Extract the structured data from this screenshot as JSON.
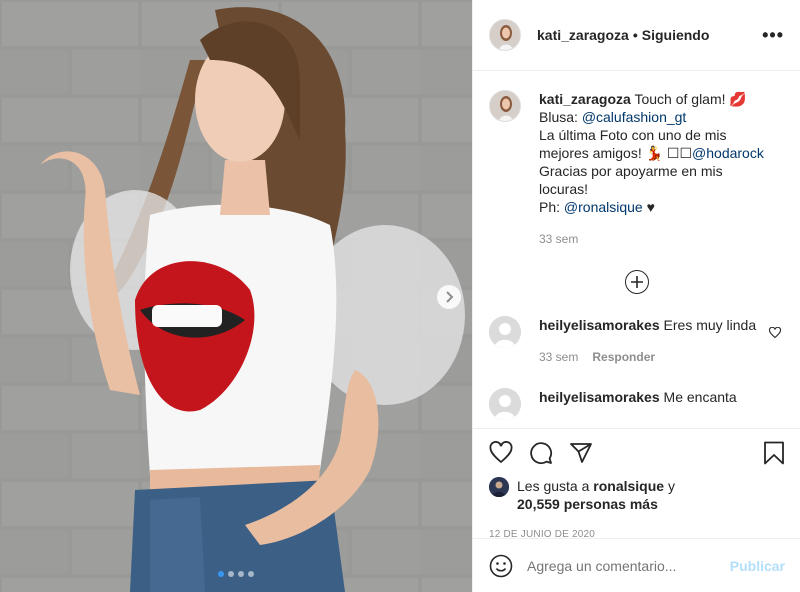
{
  "post": {
    "username": "kati_zaragoza",
    "separator": "•",
    "follow_status": "Siguiendo",
    "more_label": "•••"
  },
  "caption": {
    "username": "kati_zaragoza",
    "line1": " Touch of glam! 💋",
    "blusa_prefix": "Blusa: ",
    "blusa_handle": "@calufashion_gt",
    "line3": "La última Foto con uno de mis mejores amigos! 💃 ",
    "line3_glyphs": "☐☐",
    "line3_handle": "@hodarock",
    "line4": "Gracias por apoyarme en mis locuras!",
    "ph_prefix": "Ph: ",
    "ph_handle": "@ronalsique",
    "ph_suffix": " ♥",
    "time": "33 sem"
  },
  "comments": [
    {
      "username": "heilyelisamorakes",
      "text": " Eres muy linda",
      "time": "33 sem",
      "reply": "Responder"
    },
    {
      "username": "heilyelisamorakes",
      "text": " Me encanta",
      "time": "",
      "reply": ""
    }
  ],
  "likes": {
    "prefix": "Les gusta a ",
    "user": "ronalsique",
    "suffix": " y",
    "count": "20,559 personas más"
  },
  "date": "12 DE JUNIO DE 2020",
  "add_comment": {
    "placeholder": "Agrega un comentario...",
    "publish": "Publicar"
  },
  "carousel": {
    "total": 4,
    "active": 0
  },
  "colors": {
    "link": "#00376b",
    "publish_disabled": "#b2dffc",
    "meta": "#8e8e8e",
    "dot_active": "#3897f0",
    "lips": "#c4151c"
  },
  "icons": [
    "heart-icon",
    "comment-icon",
    "share-icon",
    "bookmark-icon",
    "emoji-icon",
    "plus-circle-icon",
    "chevron-right-icon",
    "more-icon"
  ]
}
